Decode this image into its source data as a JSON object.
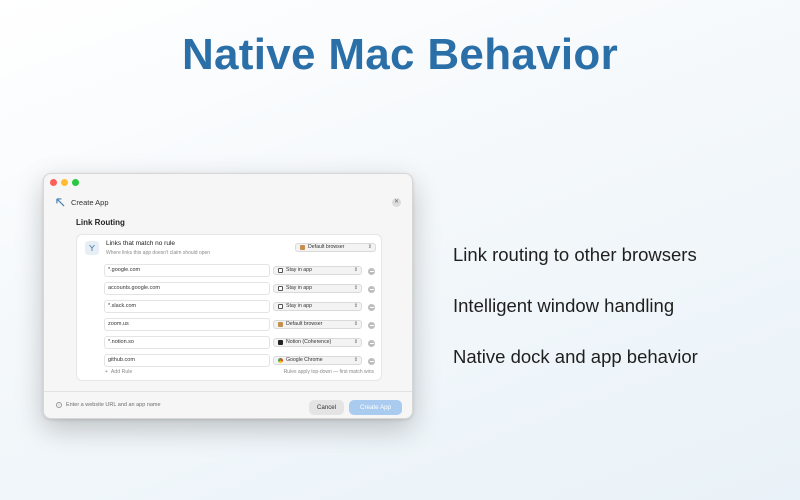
{
  "headline": "Native Mac Behavior",
  "features": [
    "Link routing to other browsers",
    "Intelligent window handling",
    "Native dock and app behavior"
  ],
  "window": {
    "title": "Create App",
    "section_title": "Link Routing",
    "unmatched": {
      "title": "Links that match no rule",
      "subtitle": "Where links this app doesn't claim should open",
      "target": "Default browser"
    },
    "rules": [
      {
        "pattern": "*.google.com",
        "target": "Stay in app",
        "icon": "window-icon"
      },
      {
        "pattern": "accounts.google.com",
        "target": "Stay in app",
        "icon": "window-icon"
      },
      {
        "pattern": "*.slack.com",
        "target": "Stay in app",
        "icon": "window-icon"
      },
      {
        "pattern": "zoom.us",
        "target": "Default browser",
        "icon": "browser-icon"
      },
      {
        "pattern": "*.notion.so",
        "target": "Notion (Coherence)",
        "icon": "notion-icon"
      },
      {
        "pattern": "github.com",
        "target": "Google Chrome",
        "icon": "chrome-icon"
      }
    ],
    "add_rule_label": "Add Rule",
    "rules_hint": "Rules apply top-down — first match wins",
    "footer_hint": "Enter a website URL and an app name",
    "cancel_label": "Cancel",
    "create_label": "Create App"
  },
  "colors": {
    "headline": "#2a6fa8",
    "create_button": "#a9cbef",
    "close_dot": "#fe5f57",
    "minimize_dot": "#febc2e",
    "zoom_dot": "#28c840"
  }
}
